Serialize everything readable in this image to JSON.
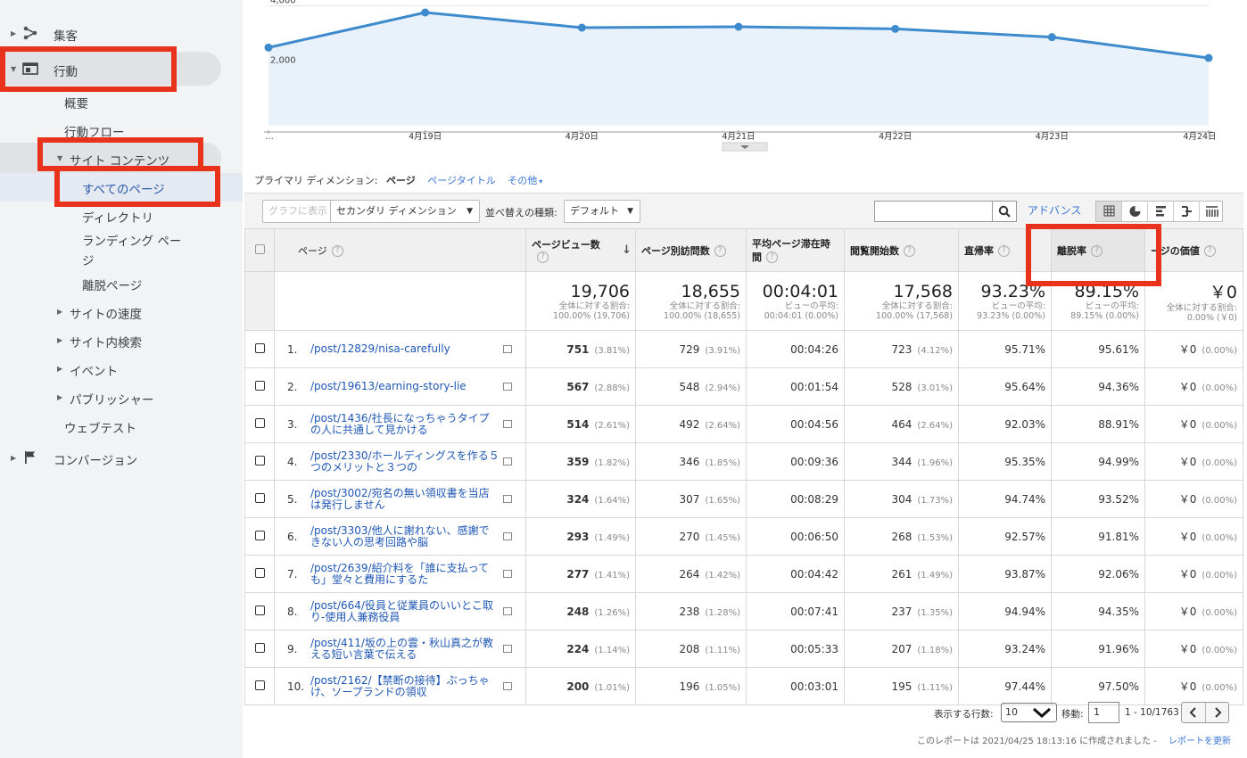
{
  "sidebar": {
    "acquisition": "集客",
    "behavior": "行動",
    "overview": "概要",
    "behavior_flow": "行動フロー",
    "site_content": "サイト コンテンツ",
    "all_pages": "すべてのページ",
    "directory": "ディレクトリ",
    "landing_page_1": "ランディング ペー",
    "landing_page_2": "ジ",
    "exit_pages": "離脱ページ",
    "site_speed": "サイトの速度",
    "site_search": "サイト内検索",
    "events": "イベント",
    "publisher": "パブリッシャー",
    "web_test": "ウェブテスト",
    "conversions": "コンバージョン"
  },
  "chart_data": {
    "type": "line",
    "categories": [
      "…",
      "4月19日",
      "4月20日",
      "4月21日",
      "4月22日",
      "4月23日",
      "4月24日"
    ],
    "values": [
      2600,
      3780,
      3270,
      3300,
      3230,
      2950,
      2250
    ],
    "y_ticks": [
      "4,000",
      "2,000"
    ],
    "ylim": [
      0,
      4200
    ],
    "color": "#3d8bcc"
  },
  "dimension": {
    "label": "プライマリ ディメンション:",
    "current": "ページ",
    "page_title": "ページタイトル",
    "other": "その他"
  },
  "toolbar": {
    "graph_button": "グラフに表示",
    "secondary_dim": "セカンダリ ディメンション",
    "sort_label": "並べ替えの種類:",
    "sort_value": "デフォルト",
    "advanced": "アドバンス"
  },
  "table": {
    "headers": {
      "page": "ページ",
      "pageviews": "ページビュー数",
      "unique": "ページ別訪問数",
      "avg_time": "平均ページ滞在時間",
      "entrances": "閲覧開始数",
      "bounce": "直帰率",
      "exit": "離脱率",
      "value": "ージの価値"
    },
    "summary": {
      "pageviews": "19,706",
      "pageviews_sub1": "全体に対する割合:",
      "pageviews_sub2": "100.00% (19,706)",
      "unique": "18,655",
      "unique_sub1": "全体に対する割合:",
      "unique_sub2": "100.00% (18,655)",
      "avg_time": "00:04:01",
      "avg_time_sub1": "ビューの平均:",
      "avg_time_sub2": "00:04:01 (0.00%)",
      "entrances": "17,568",
      "entrances_sub1": "全体に対する割合:",
      "entrances_sub2": "100.00% (17,568)",
      "bounce": "93.23%",
      "bounce_sub1": "ビューの平均:",
      "bounce_sub2": "93.23% (0.00%)",
      "exit": "89.15%",
      "exit_sub1": "ビューの平均:",
      "exit_sub2": "89.15% (0.00%)",
      "value": "￥0",
      "value_sub1": "全体に対する割合:",
      "value_sub2": "0.00% (￥0)"
    },
    "rows": [
      {
        "idx": "1.",
        "page": "/post/12829/nisa-carefully",
        "pv": "751",
        "pv_pct": "(3.81%)",
        "uv": "729",
        "uv_pct": "(3.91%)",
        "time": "00:04:26",
        "ent": "723",
        "ent_pct": "(4.12%)",
        "bounce": "95.71%",
        "exit": "95.61%",
        "val": "￥0",
        "val_pct": "(0.00%)"
      },
      {
        "idx": "2.",
        "page": "/post/19613/earning-story-lie",
        "pv": "567",
        "pv_pct": "(2.88%)",
        "uv": "548",
        "uv_pct": "(2.94%)",
        "time": "00:01:54",
        "ent": "528",
        "ent_pct": "(3.01%)",
        "bounce": "95.64%",
        "exit": "94.36%",
        "val": "￥0",
        "val_pct": "(0.00%)"
      },
      {
        "idx": "3.",
        "page": "/post/1436/社長になっちゃうタイプの人に共通して見かける",
        "pv": "514",
        "pv_pct": "(2.61%)",
        "uv": "492",
        "uv_pct": "(2.64%)",
        "time": "00:04:56",
        "ent": "464",
        "ent_pct": "(2.64%)",
        "bounce": "92.03%",
        "exit": "88.91%",
        "val": "￥0",
        "val_pct": "(0.00%)"
      },
      {
        "idx": "4.",
        "page": "/post/2330/ホールディングスを作る５つのメリットと３つの",
        "pv": "359",
        "pv_pct": "(1.82%)",
        "uv": "346",
        "uv_pct": "(1.85%)",
        "time": "00:09:36",
        "ent": "344",
        "ent_pct": "(1.96%)",
        "bounce": "95.35%",
        "exit": "94.99%",
        "val": "￥0",
        "val_pct": "(0.00%)"
      },
      {
        "idx": "5.",
        "page": "/post/3002/宛名の無い領収書を当店は発行しません",
        "pv": "324",
        "pv_pct": "(1.64%)",
        "uv": "307",
        "uv_pct": "(1.65%)",
        "time": "00:08:29",
        "ent": "304",
        "ent_pct": "(1.73%)",
        "bounce": "94.74%",
        "exit": "93.52%",
        "val": "￥0",
        "val_pct": "(0.00%)"
      },
      {
        "idx": "6.",
        "page": "/post/3303/他人に謝れない、感謝できない人の思考回路や脳",
        "pv": "293",
        "pv_pct": "(1.49%)",
        "uv": "270",
        "uv_pct": "(1.45%)",
        "time": "00:06:50",
        "ent": "268",
        "ent_pct": "(1.53%)",
        "bounce": "92.57%",
        "exit": "91.81%",
        "val": "￥0",
        "val_pct": "(0.00%)"
      },
      {
        "idx": "7.",
        "page": "/post/2639/紹介料を「誰に支払っても」堂々と費用にするた",
        "pv": "277",
        "pv_pct": "(1.41%)",
        "uv": "264",
        "uv_pct": "(1.42%)",
        "time": "00:04:42",
        "ent": "261",
        "ent_pct": "(1.49%)",
        "bounce": "93.87%",
        "exit": "92.06%",
        "val": "￥0",
        "val_pct": "(0.00%)"
      },
      {
        "idx": "8.",
        "page": "/post/664/役員と従業員のいいとこ取り-使用人兼務役員",
        "pv": "248",
        "pv_pct": "(1.26%)",
        "uv": "238",
        "uv_pct": "(1.28%)",
        "time": "00:07:41",
        "ent": "237",
        "ent_pct": "(1.35%)",
        "bounce": "94.94%",
        "exit": "94.35%",
        "val": "￥0",
        "val_pct": "(0.00%)"
      },
      {
        "idx": "9.",
        "page": "/post/411/坂の上の雲・秋山真之が教える短い言葉で伝える",
        "pv": "224",
        "pv_pct": "(1.14%)",
        "uv": "208",
        "uv_pct": "(1.11%)",
        "time": "00:05:33",
        "ent": "207",
        "ent_pct": "(1.18%)",
        "bounce": "93.24%",
        "exit": "91.96%",
        "val": "￥0",
        "val_pct": "(0.00%)"
      },
      {
        "idx": "10.",
        "page": "/post/2162/【禁断の接待】ぶっちゃけ、ソープランドの領収",
        "pv": "200",
        "pv_pct": "(1.01%)",
        "uv": "196",
        "uv_pct": "(1.05%)",
        "time": "00:03:01",
        "ent": "195",
        "ent_pct": "(1.11%)",
        "bounce": "97.44%",
        "exit": "97.50%",
        "val": "￥0",
        "val_pct": "(0.00%)"
      }
    ]
  },
  "pagination": {
    "rows_label": "表示する行数:",
    "rows_value": "10",
    "goto_label": "移動:",
    "goto_value": "1",
    "range": "1 - 10/1763"
  },
  "report_note": "このレポートは 2021/04/25 18:13:16 に作成されました -",
  "refresh_link": "レポートを更新"
}
